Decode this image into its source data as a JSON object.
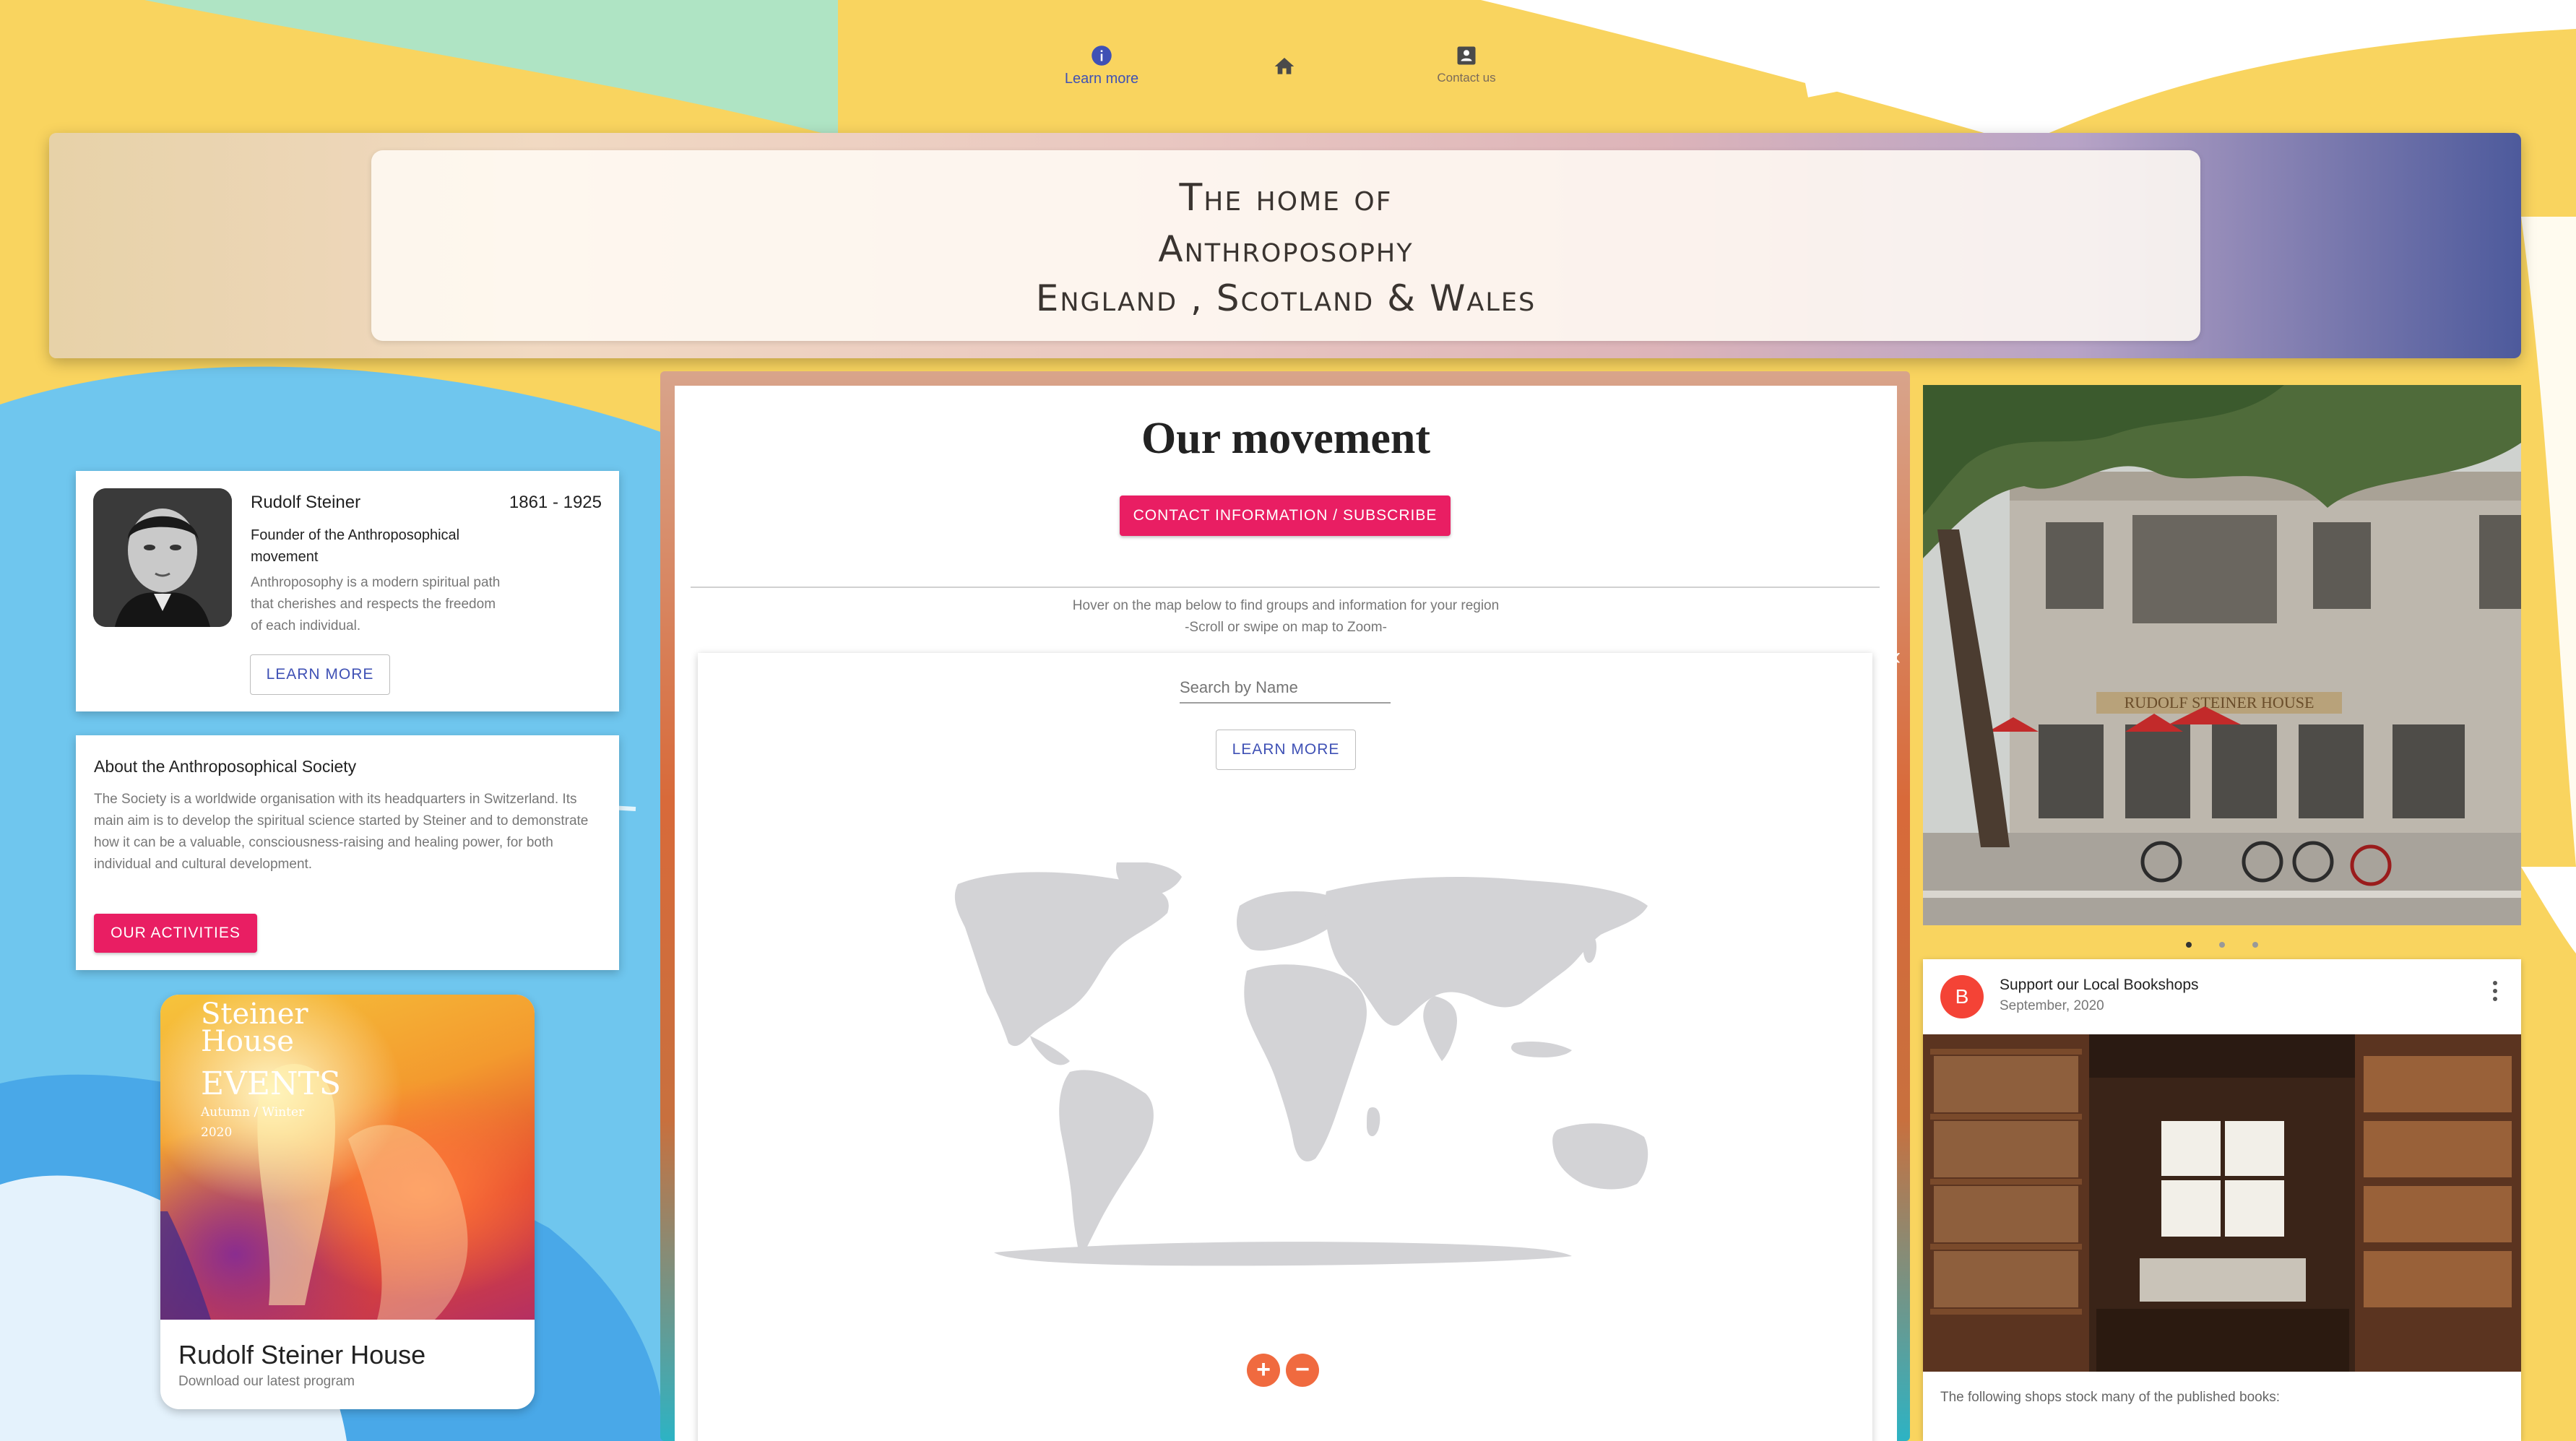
{
  "nav": {
    "items": [
      {
        "label": "Learn more",
        "icon": "info-icon"
      },
      {
        "label": "",
        "icon": "home-icon"
      },
      {
        "label": "Contact us",
        "icon": "contact-card-icon"
      }
    ]
  },
  "banner": {
    "line1": "The home of",
    "line2": "Anthroposophy",
    "line3": "England , Scotland & Wales"
  },
  "steiner_card": {
    "name": "Rudolf Steiner",
    "years": "1861 - 1925",
    "subtitle": "Founder of the Anthroposophical movement",
    "description": "Anthroposophy is a modern spiritual path that cherishes and respects the freedom of each individual.",
    "button": "LEARN MORE"
  },
  "about_card": {
    "title": "About the Anthroposophical Society",
    "text": "The Society is a worldwide organisation with its headquarters in Switzerland. Its main aim is to develop the spiritual science started by Steiner and to demonstrate how it can be a valuable, consciousness-raising and healing power, for both individual and cultural development.",
    "button": "OUR ACTIVITIES"
  },
  "house_card": {
    "image_line1": "Steiner",
    "image_line2": "House",
    "image_line3": "EVENTS",
    "image_line4": "Autumn / Winter",
    "image_line5": "2020",
    "title": "Rudolf Steiner House",
    "subtitle": "Download our latest program"
  },
  "movement": {
    "title": "Our movement",
    "contact_button": "CONTACT INFORMATION / SUBSCRIBE",
    "hint1": "Hover on the map below to find groups and information for your region",
    "hint2": "-Scroll or swipe on map to Zoom-",
    "search_placeholder": "Search by Name",
    "learn_button": "LEARN MORE",
    "zoom_in": "+",
    "zoom_out": "−"
  },
  "carousel": {
    "building_sign": "RUDOLF STEINER HOUSE",
    "dots": 3,
    "active_dot": 0
  },
  "post": {
    "avatar_letter": "B",
    "title": "Support our Local Bookshops",
    "date": "September, 2020",
    "text": "The following shops stock many of the published books:"
  },
  "colors": {
    "accent_pink": "#e91e63",
    "primary_indigo": "#3f51b5",
    "zoom_orange": "#f06a3f",
    "avatar_red": "#f44336",
    "page_yellow": "#f9d45f",
    "map_grey": "#d3d3d6"
  }
}
